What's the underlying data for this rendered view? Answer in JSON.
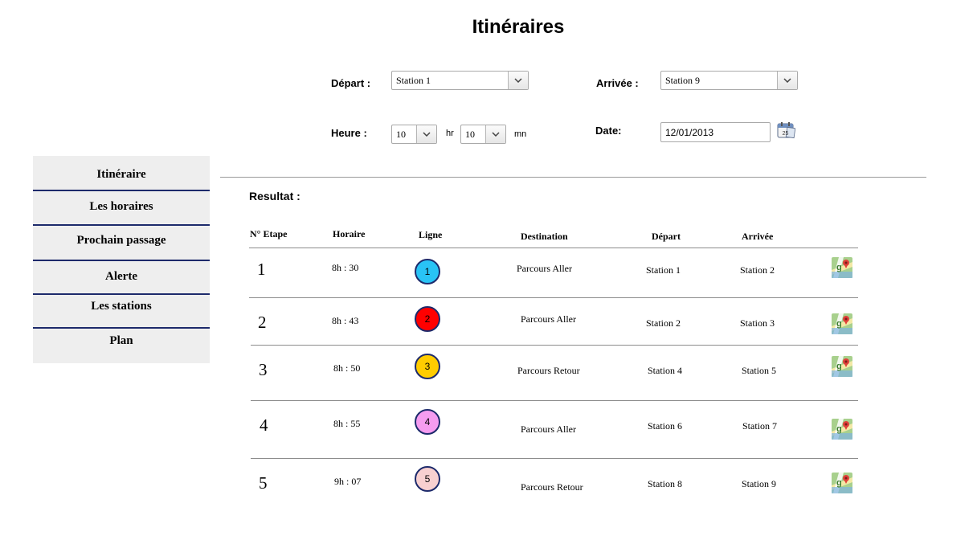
{
  "page": {
    "title": "Itinéraires"
  },
  "form": {
    "depart_label": "Départ :",
    "depart_value": "Station 1",
    "arrivee_label": "Arrivée :",
    "arrivee_value": "Station 9",
    "heure_label": "Heure :",
    "hour_value": "10",
    "hour_unit": "hr",
    "minute_value": "10",
    "minute_unit": "mn",
    "date_label": "Date:",
    "date_value": "12/01/2013",
    "calendar_day": "25"
  },
  "sidebar": {
    "items": [
      {
        "label": "Itinéraire"
      },
      {
        "label": "Les horaires"
      },
      {
        "label": "Prochain passage"
      },
      {
        "label": "Alerte"
      },
      {
        "label": "Les stations"
      },
      {
        "label": "Plan"
      }
    ]
  },
  "results": {
    "label": "Resultat :",
    "headers": [
      "N° Etape",
      "Horaire",
      "Ligne",
      "Destination",
      "Départ",
      "Arrivée"
    ],
    "rows": [
      {
        "step": "1",
        "horaire": "8h : 30",
        "ligne": "1",
        "color": "#29c3f5",
        "destination": "Parcours Aller",
        "depart": "Station 1",
        "arrivee": "Station 2"
      },
      {
        "step": "2",
        "horaire": "8h : 43",
        "ligne": "2",
        "color": "#ff0000",
        "destination": "Parcours Aller",
        "depart": "Station 2",
        "arrivee": "Station 3"
      },
      {
        "step": "3",
        "horaire": "8h : 50",
        "ligne": "3",
        "color": "#ffcc00",
        "destination": "Parcours Retour",
        "depart": "Station 4",
        "arrivee": "Station 5"
      },
      {
        "step": "4",
        "horaire": "8h : 55",
        "ligne": "4",
        "color": "#f59cf0",
        "destination": "Parcours Aller",
        "depart": "Station 6",
        "arrivee": "Station 7"
      },
      {
        "step": "5",
        "horaire": "9h : 07",
        "ligne": "5",
        "color": "#f8d0d0",
        "destination": "Parcours Retour",
        "depart": "Station 8",
        "arrivee": "Station 9"
      }
    ]
  },
  "icons": {
    "dropdown": "chevron-down-icon",
    "calendar": "calendar-icon",
    "map": "google-maps-icon"
  }
}
